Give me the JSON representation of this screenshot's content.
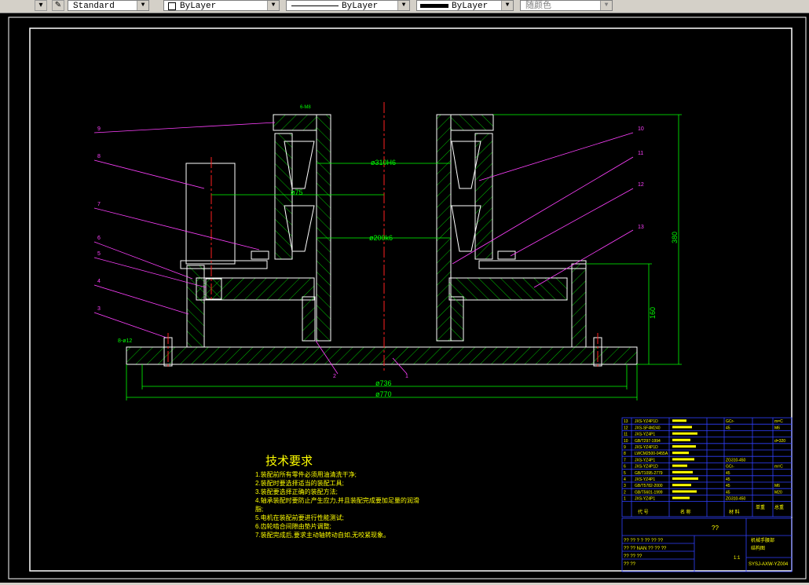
{
  "toolbar": {
    "text_style": "Standard",
    "layer": "ByLayer",
    "linetype": "ByLayer",
    "lineweight": "ByLayer",
    "color": "随颜色"
  },
  "drawing": {
    "dims": {
      "d310": "ø310H6",
      "d200": "ø200k6",
      "d75": "ø75",
      "d736": "ø736",
      "d770": "ø770",
      "h380": "380",
      "h160": "160",
      "bolt": "8-ø12",
      "top_small": "6-M8"
    },
    "callouts": [
      "1",
      "2",
      "3",
      "4",
      "5",
      "6",
      "7",
      "8",
      "9",
      "10",
      "11",
      "12",
      "13"
    ],
    "tech_req": {
      "title": "技术要求",
      "lines": [
        "1.装配前所有零件必须用油清洗干净;",
        "2.装配时要选择适当的装配工具;",
        "3.装配要选择正确的装配方法;",
        "4.轴承装配时要防止产生应力,并且装配完成要加足量的润滑",
        "脂;",
        "5.电机在装配前要进行性能测试;",
        "6.齿轮啮合间隙由垫片调整;",
        "7.装配完成后,要求主动轴转动自如,无咬紧现象。"
      ]
    },
    "bom": [
      {
        "no": "13",
        "code": "JXS-YZ4P1D",
        "mat": "GCr-",
        "rem": "m=C"
      },
      {
        "no": "12",
        "code": "JXS-SF4M240",
        "mat": "45",
        "rem": "M6"
      },
      {
        "no": "11",
        "code": "JXS-YZ4P1",
        "mat": "",
        "rem": ""
      },
      {
        "no": "10",
        "code": "GB/T297-1994",
        "mat": "",
        "rem": "d=320"
      },
      {
        "no": "9",
        "code": "JXS-YZ4P1D",
        "mat": "",
        "rem": ""
      },
      {
        "no": "8",
        "code": "LWCM2500-0455A",
        "mat": "",
        "rem": ""
      },
      {
        "no": "7",
        "code": "JXS-YZ4P1",
        "mat": "ZG310-450",
        "rem": ""
      },
      {
        "no": "6",
        "code": "JXS-YZ4P1D",
        "mat": "GCr-",
        "rem": "m=C"
      },
      {
        "no": "5",
        "code": "GB/T1095-2779",
        "mat": "45",
        "rem": ""
      },
      {
        "no": "4",
        "code": "JXS-YZ4P1",
        "mat": "45",
        "rem": ""
      },
      {
        "no": "3",
        "code": "GB/T5782-2000",
        "mat": "45",
        "rem": "M6"
      },
      {
        "no": "2",
        "code": "GB/T5601-1999",
        "mat": "45",
        "rem": "M20"
      },
      {
        "no": "1",
        "code": "JXS-YZ4P1",
        "mat": "ZG310-450",
        "rem": ""
      }
    ],
    "bom_header": {
      "code": "代 号",
      "name": "名 称",
      "mat": "材 料",
      "wt": "单重",
      "tot": "总重"
    },
    "title_block": {
      "q": "??",
      "name1": "机械手腰部",
      "name2": "结构图",
      "code": "SYSJ-AXW-YZ004",
      "scale": "1:1",
      "r1": "?? ?? ? ?  ??  ??  ??",
      "r2": "?? ?? NAN  ?? ??  ??",
      "r3": "?? ?? ??",
      "r4": "?? ??"
    }
  }
}
